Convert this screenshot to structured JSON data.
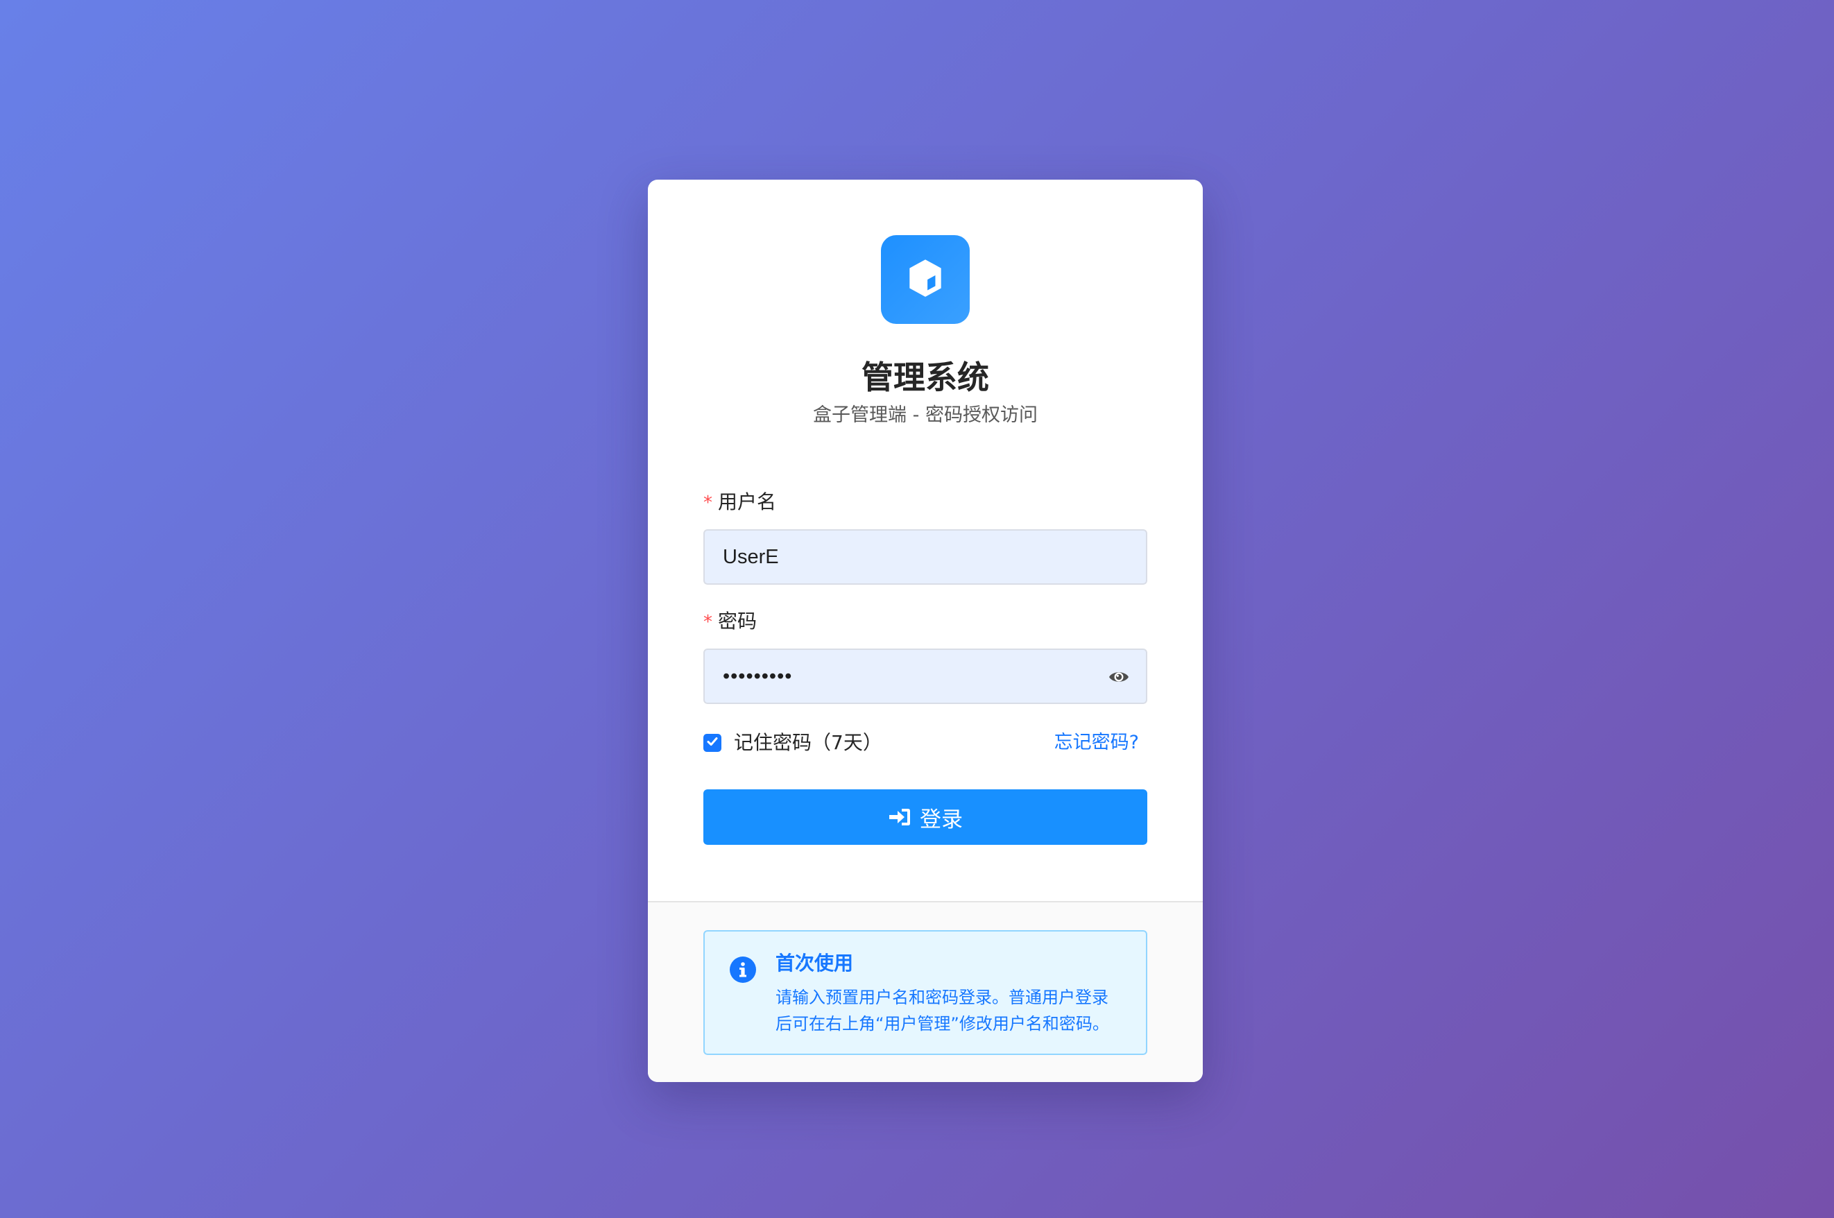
{
  "app": {
    "title": "管理系统",
    "subtitle": "盒子管理端 - 密码授权访问"
  },
  "form": {
    "username": {
      "label": "用户名",
      "required_mark": "*",
      "value": "UserE"
    },
    "password": {
      "label": "密码",
      "required_mark": "*",
      "value": "•••••••••"
    },
    "remember": {
      "label": "记住密码（7天）",
      "checked": true
    },
    "forgot_link": "忘记密码?",
    "login_label": "登录"
  },
  "notice": {
    "title": "首次使用",
    "text": "请输入预置用户名和密码登录。普通用户登录后可在右上角“用户管理”修改用户名和密码。"
  },
  "icons": {
    "logo": "cube-icon",
    "password_toggle": "eye-icon",
    "login": "sign-in-icon",
    "notice": "info-circle-icon",
    "checkbox": "check-icon"
  },
  "colors": {
    "primary": "#1890ff",
    "link": "#1677ff",
    "required": "#ff4d4f",
    "input_bg": "#e8f0fe",
    "notice_bg": "#e6f7ff",
    "notice_border": "#91d5ff"
  }
}
